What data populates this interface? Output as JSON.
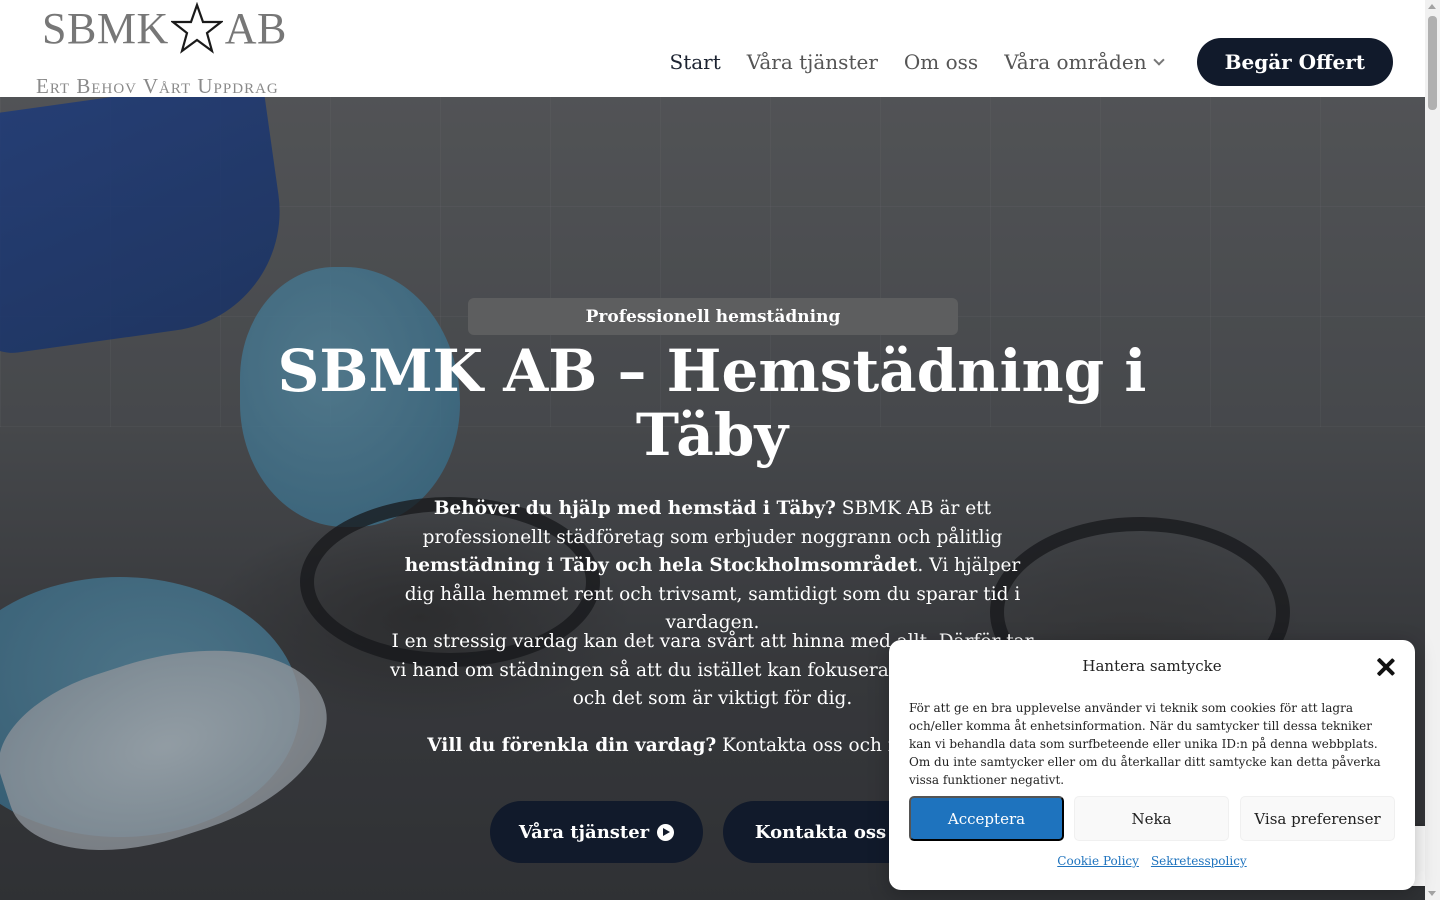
{
  "brand": {
    "name_left": "SBMK",
    "name_right": "AB",
    "tagline": "Ert Behov Vårt Uppdrag",
    "icon": "star-outline-icon"
  },
  "nav": {
    "items": [
      {
        "label": "Start"
      },
      {
        "label": "Våra tjänster"
      },
      {
        "label": "Om oss"
      },
      {
        "label": "Våra områden"
      }
    ],
    "cta_label": "Begär Offert"
  },
  "hero": {
    "badge": "Professionell hemstädning",
    "title": "SBMK AB – Hemstädning i Täby",
    "p1": {
      "b1": "Behöver du hjälp med hemstäd i Täby?",
      "t1": " SBMK AB är ett professionellt städföretag som erbjuder noggrann och pålitlig ",
      "b2": "hemstädning i Täby och hela Stockholmsområdet",
      "t2": ". Vi hjälper dig hålla hemmet rent och trivsamt, samtidigt som du sparar tid i vardagen."
    },
    "p2": "I en stressig vardag kan det vara svårt att hinna med allt. Därför tar vi hand om städningen så att du istället kan fokusera på familj, fritid och det som är viktigt för dig.",
    "p3": {
      "b1": "Vill du förenkla din vardag?",
      "t1": " Kontakta oss och få en offert."
    },
    "btn_services": "Våra tjänster",
    "btn_contact": "Kontakta oss"
  },
  "cookie": {
    "title": "Hantera samtycke",
    "body": "För att ge en bra upplevelse använder vi teknik som cookies för att lagra och/eller komma åt enhetsinformation. När du samtycker till dessa tekniker kan vi behandla data som surfbeteende eller unika ID:n på denna webbplats. Om du inte samtycker eller om du återkallar ditt samtycke kan detta påverka vissa funktioner negativt.",
    "accept": "Acceptera",
    "deny": "Neka",
    "preferences": "Visa preferenser",
    "link_cookie": "Cookie Policy",
    "link_privacy": "Sekretesspolicy"
  },
  "colors": {
    "navy": "#111a2b",
    "accept_blue": "#1e73be",
    "logo_gray": "#777777"
  }
}
